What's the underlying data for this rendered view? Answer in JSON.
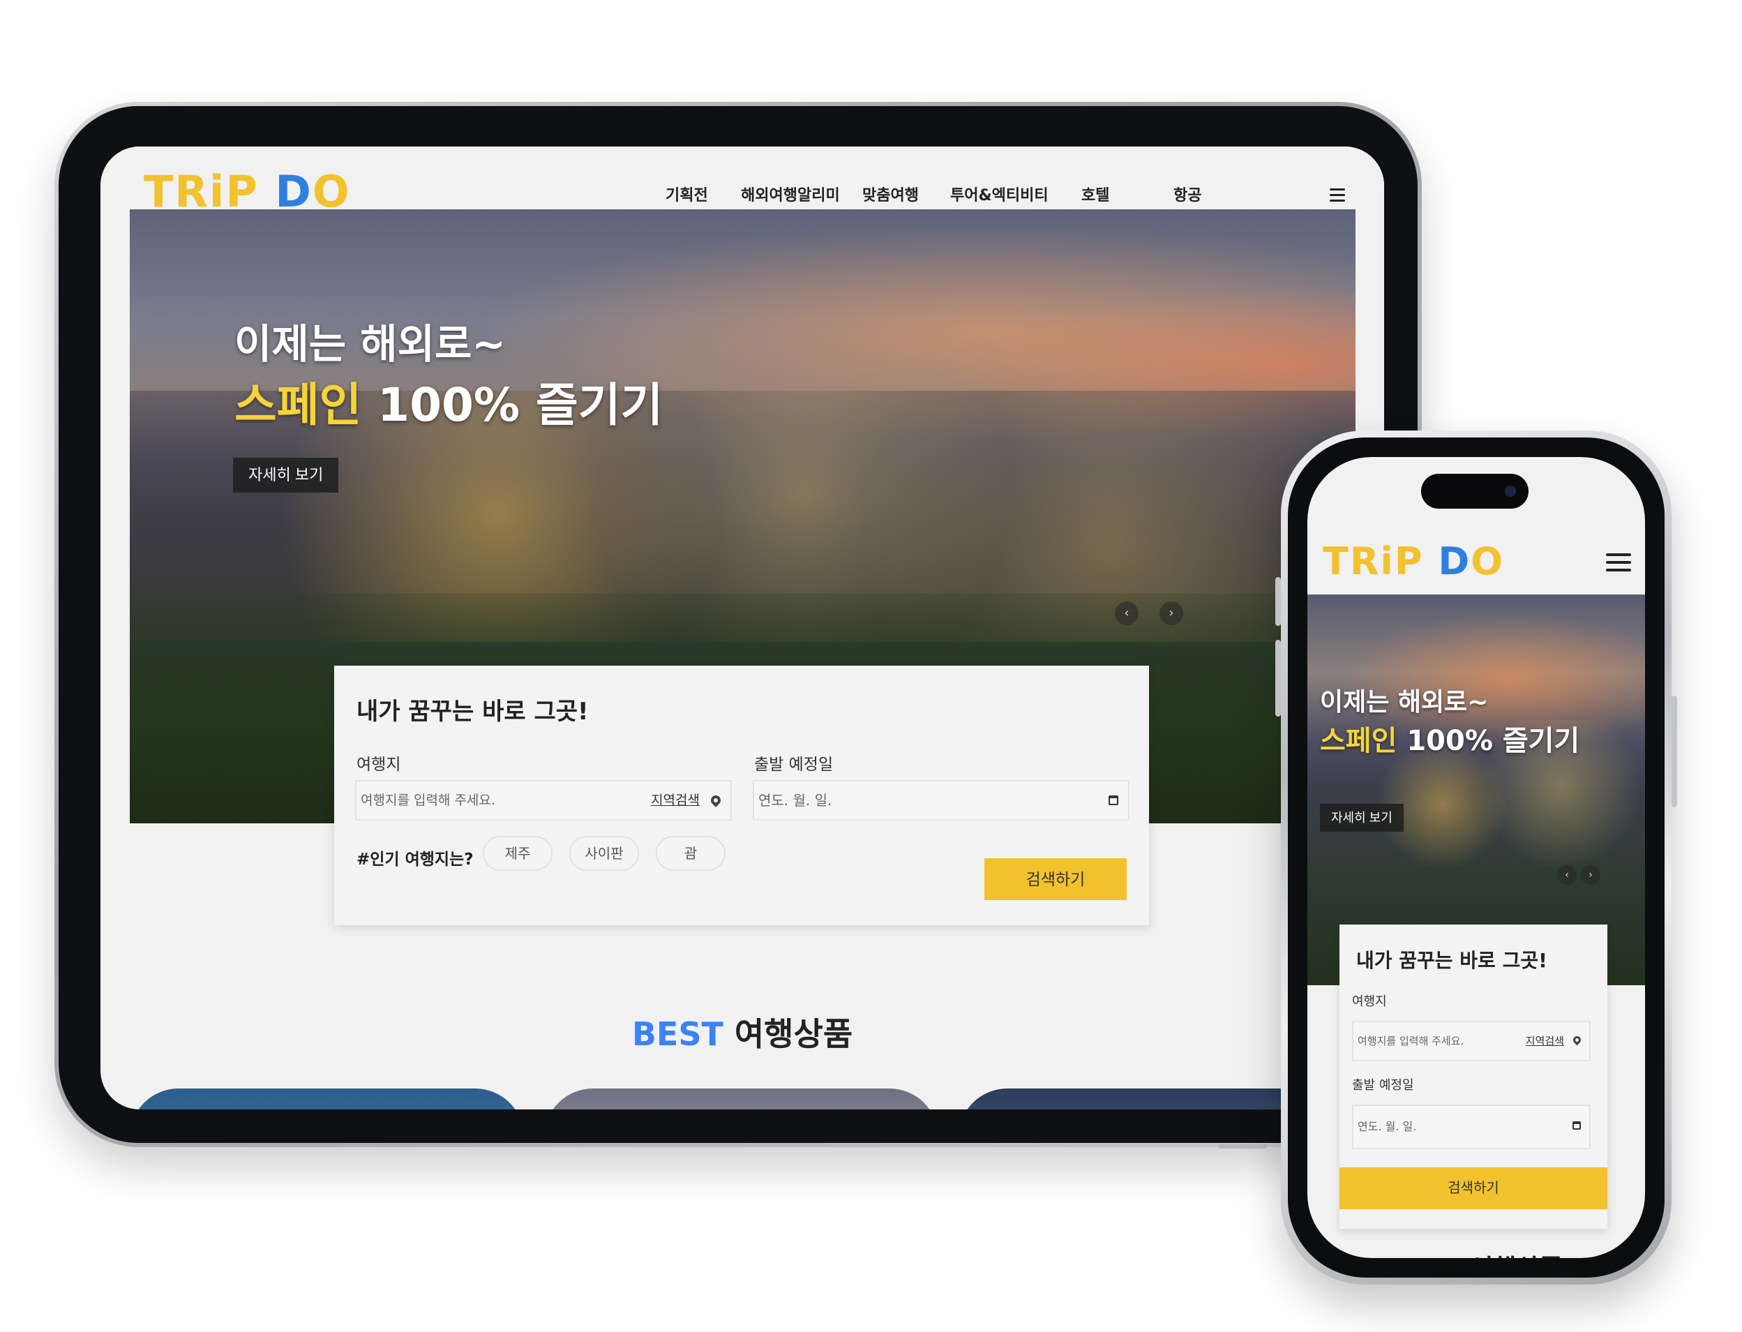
{
  "brand": {
    "logo_left": "TR",
    "logo_i": "i",
    "logo_p": "P ",
    "logo_d": "D",
    "logo_o": "O"
  },
  "colors": {
    "accent_yellow": "#f2c12e",
    "brand_blue": "#3b82f6",
    "hero_highlight": "#f5d43a"
  },
  "nav": {
    "items": [
      "기획전",
      "해외여행알리미",
      "맞춤여행",
      "투어&엑티비티",
      "호텔",
      "항공"
    ],
    "menu_icon": "hamburger-icon"
  },
  "hero": {
    "line1": "이제는 해외로~",
    "highlight": "스페인",
    "line2_rest": " 100% 즐기기",
    "more_button": "자세히 보기",
    "prev_icon": "chevron-left-icon",
    "next_icon": "chevron-right-icon",
    "prev_glyph": "‹",
    "next_glyph": "›"
  },
  "search": {
    "title": "내가 꿈꾸는 바로 그곳!",
    "destination_label": "여행지",
    "destination_placeholder": "여행지를 입력해 주세요.",
    "region_search": "지역검색",
    "date_label": "출발 예정일",
    "date_placeholder": "연도. 월. 일.",
    "popular_label": "#인기 여행지는?",
    "popular_chips": [
      "제주",
      "사이판",
      "괌"
    ],
    "submit": "검색하기"
  },
  "best": {
    "highlight": "BEST",
    "rest": " 여행상품"
  }
}
